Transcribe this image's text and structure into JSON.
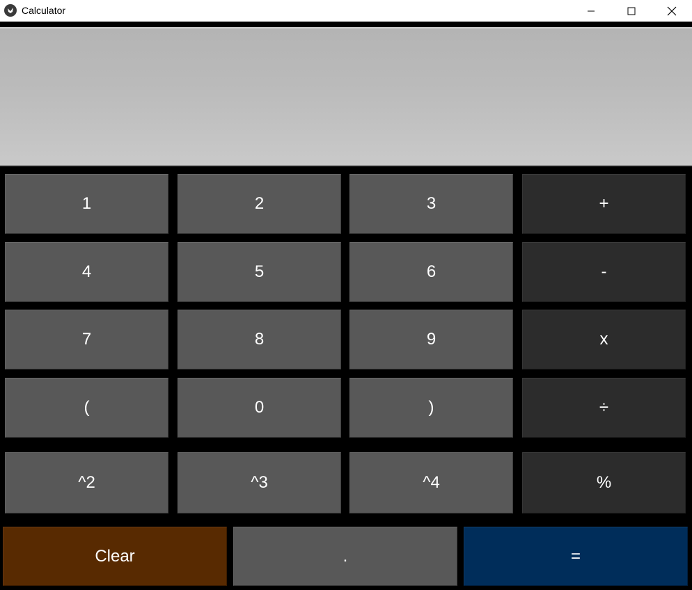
{
  "window": {
    "title": "Calculator",
    "icon": "kivy-logo-icon"
  },
  "display": {
    "value": ""
  },
  "keypad": {
    "rows": [
      [
        "1",
        "2",
        "3",
        "+"
      ],
      [
        "4",
        "5",
        "6",
        "-"
      ],
      [
        "7",
        "8",
        "9",
        "x"
      ],
      [
        "(",
        "0",
        ")",
        "÷"
      ],
      [
        "^2",
        "^3",
        "^4",
        "%"
      ]
    ],
    "bottom": {
      "clear": "Clear",
      "dot": ".",
      "equals": "="
    }
  },
  "colors": {
    "number_key": "#585858",
    "operator_key": "#2c2c2c",
    "clear_key": "#582a01",
    "equals_key": "#002d5a",
    "display_bg": "#bababa",
    "background": "#000000"
  }
}
